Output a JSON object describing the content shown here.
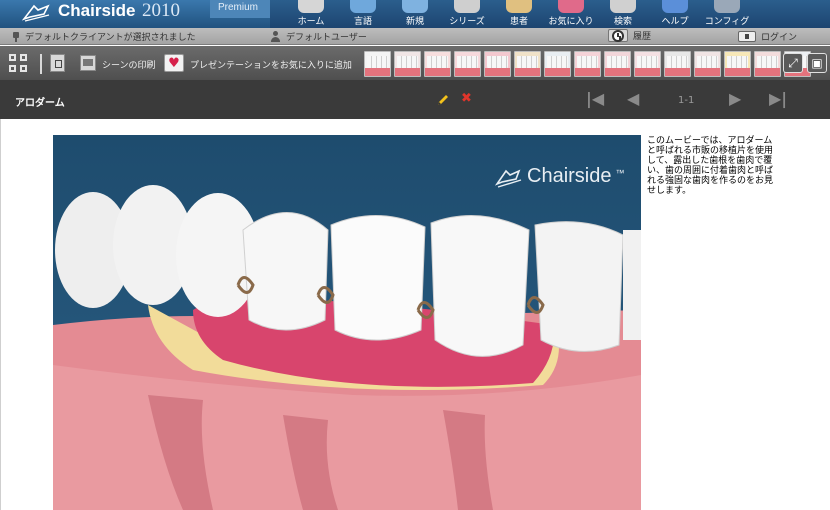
{
  "app": {
    "brand_name": "Chairside",
    "brand_year": "2010",
    "edition": "Premium"
  },
  "topnav": [
    {
      "label": "ホーム",
      "icon": "home-icon",
      "color": "#d6d6d6"
    },
    {
      "label": "言語",
      "icon": "language-icon",
      "color": "#6fa8dc"
    },
    {
      "label": "新規",
      "icon": "new-icon",
      "color": "#7fb2e0"
    },
    {
      "label": "シリーズ",
      "icon": "series-icon",
      "color": "#cfcfcf"
    },
    {
      "label": "患者",
      "icon": "patient-icon",
      "color": "#e0c080"
    },
    {
      "label": "お気に入り",
      "icon": "favorites-icon",
      "color": "#e06a8a"
    },
    {
      "label": "検索",
      "icon": "search-icon",
      "color": "#d0d0d0"
    },
    {
      "label": "ヘルプ",
      "icon": "help-icon",
      "color": "#5b8fd9"
    },
    {
      "label": "コンフィグ",
      "icon": "config-icon",
      "color": "#9aa8b8"
    }
  ],
  "statusbar": {
    "client_text": "デフォルトクライアントが選択されました",
    "user_text": "デフォルトユーザー",
    "history_label": "履歴",
    "login_label": "ログイン"
  },
  "toolbar": {
    "print_label": "シーンの印刷",
    "favorite_label": "プレゼンテーションをお気に入りに追加",
    "thumbnails": [
      {
        "name": "thumb-procedure-1",
        "bg": "#f4f4f4"
      },
      {
        "name": "thumb-procedure-2",
        "bg": "#f1e6e6"
      },
      {
        "name": "thumb-procedure-3",
        "bg": "#f7dede"
      },
      {
        "name": "thumb-procedure-4",
        "bg": "#f6d9dc"
      },
      {
        "name": "thumb-procedure-5",
        "bg": "#f3c8cf"
      },
      {
        "name": "thumb-procedure-6",
        "bg": "#f0e2c8"
      },
      {
        "name": "thumb-procedure-7",
        "bg": "#e9eef2"
      },
      {
        "name": "thumb-procedure-8",
        "bg": "#f5d3d8"
      },
      {
        "name": "thumb-procedure-9",
        "bg": "#f2d6da"
      },
      {
        "name": "thumb-procedure-10",
        "bg": "#f4e0e3"
      },
      {
        "name": "thumb-procedure-11",
        "bg": "#e8e8e8"
      },
      {
        "name": "thumb-procedure-12",
        "bg": "#f0e4e4"
      },
      {
        "name": "thumb-procedure-13",
        "bg": "#f7e8b8"
      },
      {
        "name": "thumb-procedure-14",
        "bg": "#f3dcdc"
      },
      {
        "name": "thumb-procedure-15",
        "bg": "#eef1f4"
      }
    ]
  },
  "titlebar": {
    "title": "アロダーム",
    "page_indicator": "1-1"
  },
  "content": {
    "watermark": "Chairside",
    "watermark_tm": "™",
    "description": "このムービーでは、アロダームと呼ばれる市販の移植片を使用して、露出した歯根を歯肉で覆い、歯の周囲に付着歯肉と呼ばれる強固な歯肉を作るのをお見せします。"
  }
}
